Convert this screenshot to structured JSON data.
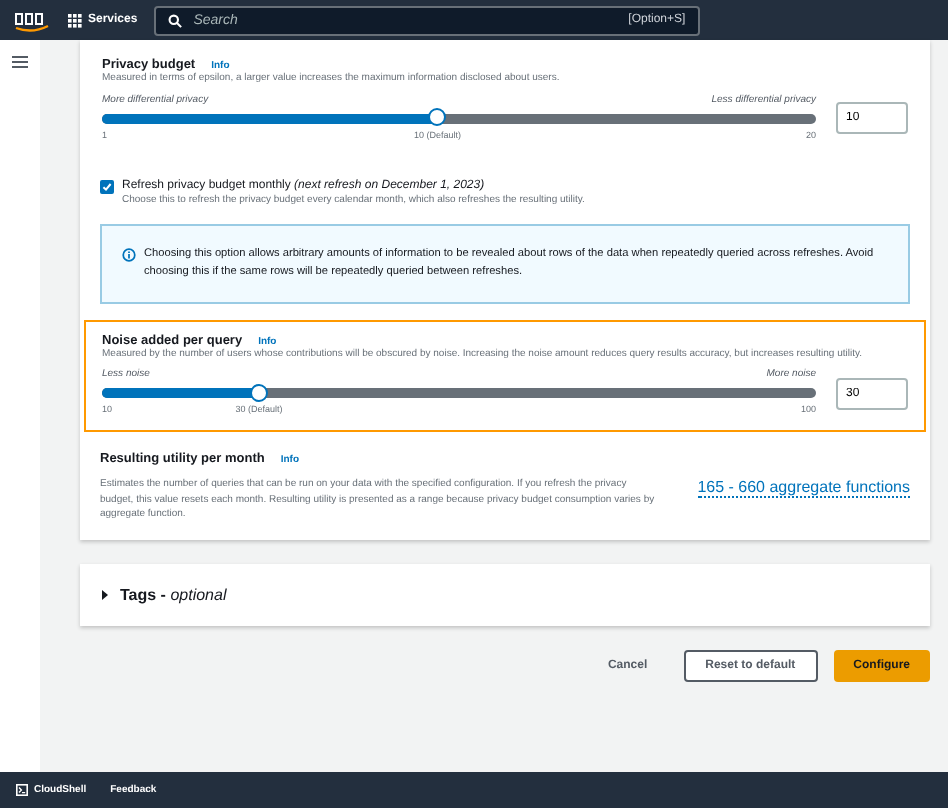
{
  "top_nav": {
    "services": "Services",
    "search": {
      "placeholder": "Search"
    },
    "shortcut": "[Option+S]"
  },
  "privacy_budget": {
    "title": "Privacy budget",
    "info": "Info",
    "description": "Measured in terms of epsilon, a larger value increases the maximum information disclosed about users.",
    "left_label": "More differential privacy",
    "right_label": "Less differential privacy",
    "level": 0.47,
    "min": "1",
    "default": "10 (Default)",
    "max": "20",
    "value": "10",
    "highlighted": false
  },
  "refresh": {
    "checked": true,
    "label": "Refresh privacy budget monthly",
    "note": "(next refresh on December 1, 2023)",
    "description": "Choose this to refresh the privacy budget every calendar month, which also refreshes the resulting utility."
  },
  "alert": "Choosing this option allows arbitrary amounts of information to be revealed about rows of the data when repeatedly queried across refreshes. Avoid choosing this if the same rows will be repeatedly queried between refreshes.",
  "noise": {
    "title": "Noise added per query",
    "info": "Info",
    "description": "Measured by the number of users whose contributions will be obscured by noise. Increasing the noise amount reduces query results accuracy, but increases resulting utility.",
    "left_label": "Less noise",
    "right_label": "More noise",
    "level": 0.22,
    "min": "10",
    "default": "30 (Default)",
    "max": "100",
    "value": "30",
    "highlighted": true
  },
  "utility": {
    "title": "Resulting utility per month",
    "info": "Info",
    "description": "Estimates the number of queries that can be run on your data with the specified configuration. If you refresh the privacy budget, this value resets each month. Resulting utility is presented as a range because privacy budget consumption varies by aggregate function.",
    "value": "165 - 660 aggregate functions"
  },
  "tags": {
    "title": "Tags -",
    "optional": "optional",
    "expanded": false
  },
  "buttons": {
    "cancel": "Cancel",
    "reset": "Reset to default",
    "configure": "Configure"
  },
  "footer": {
    "cloudshell": "CloudShell",
    "feedback": "Feedback"
  }
}
